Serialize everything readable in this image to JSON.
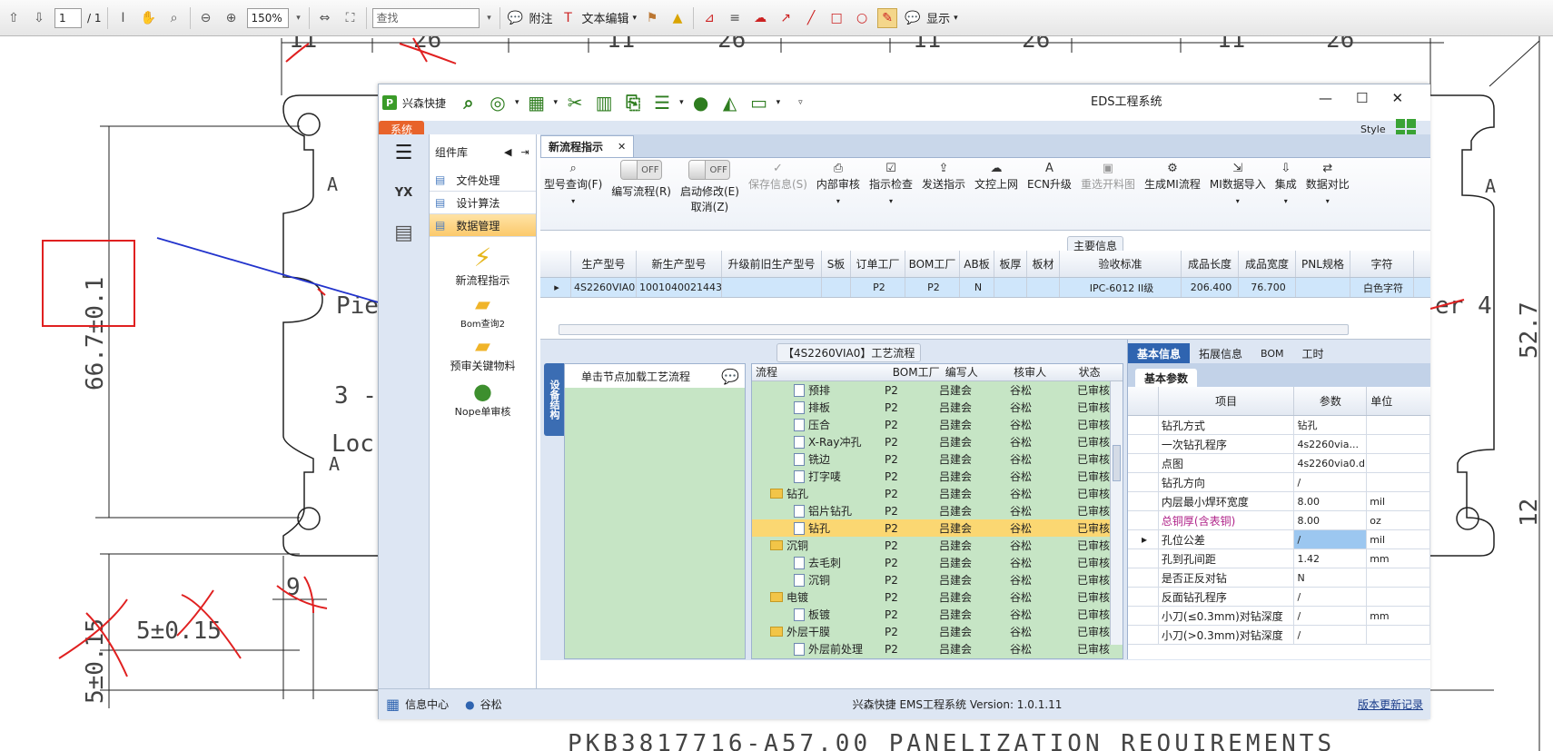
{
  "pdf_toolbar": {
    "page_value": "1",
    "page_total": "/ 1",
    "zoom_value": "150%",
    "search_placeholder": "查找",
    "comment_label": "附注",
    "text_edit_label": "文本编辑",
    "display_label": "显示"
  },
  "drawing": {
    "dim_top": [
      "11",
      "26",
      "11",
      "26",
      "11",
      "26",
      "11",
      "26"
    ],
    "dim_left": "66.7±0.1",
    "dim_bottom_left": "5±0.15",
    "dim_bottom_mid": "5±0.15",
    "dim_nine": "9",
    "label_a": "A",
    "label_a2": "A",
    "label_a3": "A",
    "label_pie": "Pie",
    "label_loc": "Loc",
    "label_three": "3 - 9",
    "label_er": "er 4",
    "dim_right_top": "52.7",
    "dim_right_bottom": "12",
    "footer_text": "PKB3817716-A57.00 PANELIZATION REQUIREMENTS",
    "accent_red": "#e02020",
    "arrow_blue": "#2233cc"
  },
  "app": {
    "brand": "兴森快捷",
    "title": "EDS工程系统",
    "system_tab": "系统",
    "style_label": "Style",
    "ribbon_icons": [
      "search-icon",
      "lifebuoy-icon",
      "grid-icon",
      "scissors-icon",
      "film-icon",
      "clipboard-icon",
      "list-icon",
      "user-icon",
      "chart-icon",
      "monitor-icon"
    ]
  },
  "left_rail": {
    "items": [
      "menu-icon",
      "yx-factory-icon",
      "calendar-icon"
    ]
  },
  "side_panel": {
    "title": "组件库",
    "items": [
      "文件处理",
      "设计算法",
      "数据管理"
    ],
    "tools": [
      "新流程指示",
      "Bom查询2",
      "预审关键物料",
      "Nope单审核"
    ]
  },
  "main": {
    "tab_label": "新流程指示",
    "ribbon": [
      {
        "label": "型号查询(F)",
        "icon": "search-icon"
      },
      {
        "label": "编写流程(R)",
        "toggle": "OFF"
      },
      {
        "label": "启动修改(E)",
        "sub": "取消(Z)",
        "toggle": "OFF"
      },
      {
        "label": "保存信息(S)",
        "icon": "check-icon",
        "disabled": true
      },
      {
        "label": "内部审核",
        "icon": "print-icon"
      },
      {
        "label": "指示检查",
        "icon": "checkbox-icon"
      },
      {
        "label": "发送指示",
        "icon": "upload-icon"
      },
      {
        "label": "文控上网",
        "icon": "cloud-icon"
      },
      {
        "label": "ECN升级",
        "icon": "a-icon"
      },
      {
        "label": "重选开料图",
        "icon": "image-icon",
        "disabled": true
      },
      {
        "label": "生成MI流程",
        "icon": "gears-icon"
      },
      {
        "label": "MI数据导入",
        "icon": "import-icon"
      },
      {
        "label": "集成",
        "icon": "download-icon"
      },
      {
        "label": "数据对比",
        "icon": "compare-icon"
      }
    ],
    "main_info_label": "主要信息",
    "grid_headers": [
      "生产型号",
      "新生产型号",
      "升级前旧生产型号",
      "S板",
      "订单工厂",
      "BOM工厂",
      "AB板",
      "板厚",
      "板材",
      "验收标准",
      "成品长度",
      "成品宽度",
      "PNL规格",
      "字符"
    ],
    "grid_row": [
      "4S2260VIA0",
      "10010400214434",
      "",
      "",
      "P2",
      "P2",
      "N",
      "",
      "",
      "IPC-6012 II级",
      "206.400",
      "76.700",
      "",
      "白色字符"
    ],
    "process_title": "【4S2260VIA0】工艺流程",
    "device_tab": "设备结构",
    "device_hint": "单击节点加载工艺流程",
    "tree_headers": [
      "流程",
      "BOM工厂",
      "编写人",
      "核审人",
      "状态"
    ],
    "tree_rows": [
      {
        "name": "预排",
        "bom": "P2",
        "writer": "吕建会",
        "reviewer": "谷松",
        "status": "已审核",
        "level": 2
      },
      {
        "name": "排板",
        "bom": "P2",
        "writer": "吕建会",
        "reviewer": "谷松",
        "status": "已审核",
        "level": 2
      },
      {
        "name": "压合",
        "bom": "P2",
        "writer": "吕建会",
        "reviewer": "谷松",
        "status": "已审核",
        "level": 2
      },
      {
        "name": "X-Ray冲孔",
        "bom": "P2",
        "writer": "吕建会",
        "reviewer": "谷松",
        "status": "已审核",
        "level": 2
      },
      {
        "name": "铣边",
        "bom": "P2",
        "writer": "吕建会",
        "reviewer": "谷松",
        "status": "已审核",
        "level": 2
      },
      {
        "name": "打字唛",
        "bom": "P2",
        "writer": "吕建会",
        "reviewer": "谷松",
        "status": "已审核",
        "level": 2
      },
      {
        "name": "钻孔",
        "bom": "P2",
        "writer": "吕建会",
        "reviewer": "谷松",
        "status": "已审核",
        "level": 1
      },
      {
        "name": "铝片钻孔",
        "bom": "P2",
        "writer": "吕建会",
        "reviewer": "谷松",
        "status": "已审核",
        "level": 2
      },
      {
        "name": "钻孔",
        "bom": "P2",
        "writer": "吕建会",
        "reviewer": "谷松",
        "status": "已审核",
        "level": 2,
        "selected": true
      },
      {
        "name": "沉铜",
        "bom": "P2",
        "writer": "吕建会",
        "reviewer": "谷松",
        "status": "已审核",
        "level": 1
      },
      {
        "name": "去毛刺",
        "bom": "P2",
        "writer": "吕建会",
        "reviewer": "谷松",
        "status": "已审核",
        "level": 2
      },
      {
        "name": "沉铜",
        "bom": "P2",
        "writer": "吕建会",
        "reviewer": "谷松",
        "status": "已审核",
        "level": 2
      },
      {
        "name": "电镀",
        "bom": "P2",
        "writer": "吕建会",
        "reviewer": "谷松",
        "status": "已审核",
        "level": 1
      },
      {
        "name": "板镀",
        "bom": "P2",
        "writer": "吕建会",
        "reviewer": "谷松",
        "status": "已审核",
        "level": 2
      },
      {
        "name": "外层干膜",
        "bom": "P2",
        "writer": "吕建会",
        "reviewer": "谷松",
        "status": "已审核",
        "level": 1
      },
      {
        "name": "外层前处理",
        "bom": "P2",
        "writer": "吕建会",
        "reviewer": "谷松",
        "status": "已审核",
        "level": 2
      }
    ],
    "prop_tabs": [
      "基本信息",
      "拓展信息",
      "BOM",
      "工时"
    ],
    "prop_subtab": "基本参数",
    "prop_headers": [
      "项目",
      "参数",
      "单位"
    ],
    "prop_rows": [
      {
        "item": "钻孔方式",
        "value": "钻孔",
        "unit": ""
      },
      {
        "item": "一次钻孔程序",
        "value": "4s2260via...",
        "unit": ""
      },
      {
        "item": "点图",
        "value": "4s2260via0.d",
        "unit": ""
      },
      {
        "item": "钻孔方向",
        "value": "/",
        "unit": ""
      },
      {
        "item": "内层最小焊环宽度",
        "value": "8.00",
        "unit": "mil"
      },
      {
        "item": "总铜厚(含表铜)",
        "value": "8.00",
        "unit": "oz",
        "highlight": true
      },
      {
        "item": "孔位公差",
        "value": "/",
        "unit": "mil",
        "current": true
      },
      {
        "item": "孔到孔间距",
        "value": "1.42",
        "unit": "mm"
      },
      {
        "item": "是否正反对钻",
        "value": "N",
        "unit": ""
      },
      {
        "item": "反面钻孔程序",
        "value": "/",
        "unit": ""
      },
      {
        "item": "小刀(≤0.3mm)对钻深度",
        "value": "/",
        "unit": "mm"
      },
      {
        "item": "小刀(>0.3mm)对钻深度",
        "value": "/",
        "unit": ""
      }
    ]
  },
  "status_bar": {
    "info_center": "信息中心",
    "user": "谷松",
    "version_text": "兴森快捷 EMS工程系统 Version: 1.0.1.11",
    "changelog_link": "版本更新记录"
  }
}
